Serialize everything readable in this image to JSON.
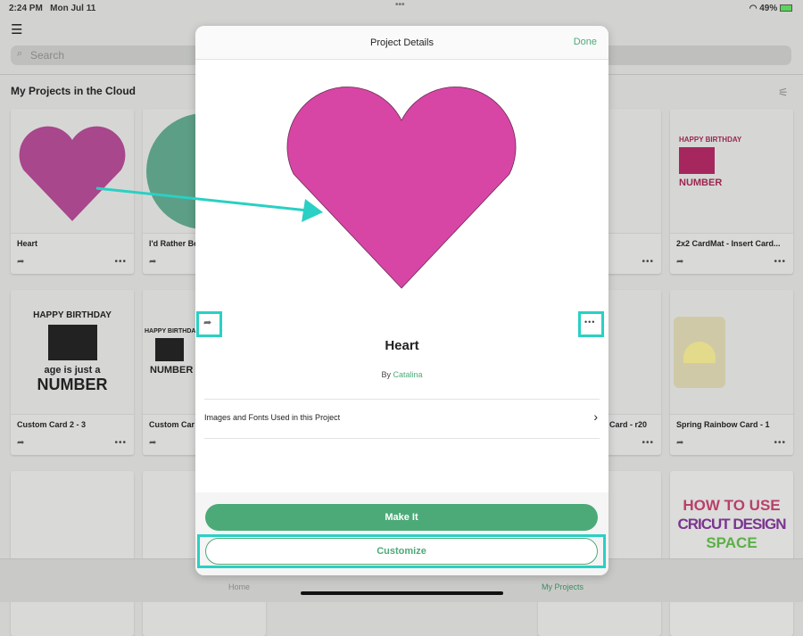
{
  "status_bar": {
    "time": "2:24 PM",
    "date": "Mon Jul 11",
    "battery": "49%"
  },
  "search": {
    "placeholder": "Search"
  },
  "section_title": "My Projects in the Cloud",
  "projects": [
    {
      "title": "Heart"
    },
    {
      "title": "I'd Rather Be"
    },
    {
      "title": "2x2 CardMat - Insert Card..."
    },
    {
      "title": "Custom Card 2 - 3"
    },
    {
      "title": "Custom Car"
    },
    {
      "title": "Card - r20"
    },
    {
      "title": "Spring Rainbow Card - 1"
    }
  ],
  "thumb_text": {
    "birthday": "HAPPY BIRTHDAY",
    "age": "age is just a",
    "number": "NUMBER",
    "howto1": "HOW TO USE",
    "howto2": "CRICUT DESIGN",
    "howto3": "SPACE"
  },
  "tabbar": {
    "home": "Home",
    "my_projects": "My Projects"
  },
  "modal": {
    "title": "Project Details",
    "done": "Done",
    "project_name": "Heart",
    "by": "By",
    "author": "Catalina",
    "images_fonts": "Images and Fonts Used in this Project",
    "make_it": "Make It",
    "customize": "Customize"
  },
  "colors": {
    "accent": "#4caa78",
    "heart": "#d846a5",
    "highlight": "#2ad0c3"
  }
}
